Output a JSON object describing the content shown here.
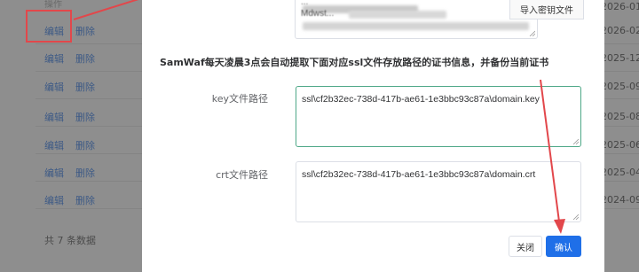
{
  "background": {
    "column_header": "操作",
    "rows": [
      {
        "edit": "编辑",
        "delete": "删除",
        "date": "2026-02-2"
      },
      {
        "edit": "编辑",
        "delete": "删除",
        "date": "2025-12-2"
      },
      {
        "edit": "编辑",
        "delete": "删除",
        "date": "2025-09-0"
      },
      {
        "edit": "编辑",
        "delete": "删除",
        "date": "2025-08-2"
      },
      {
        "edit": "编辑",
        "delete": "删除",
        "date": "2025-06-2"
      },
      {
        "edit": "编辑",
        "delete": "删除",
        "date": "2025-04-0"
      },
      {
        "edit": "编辑",
        "delete": "删除",
        "date": "2024-09-1"
      }
    ],
    "total": "共 7 条数据",
    "top_date": "2026-01-"
  },
  "dialog": {
    "blurred_line_1": "...",
    "blurred_line_2": "Mdwst...",
    "import_button": "导入密钥文件",
    "notice": "SamWaf每天凌晨3点会自动提取下面对应ssl文件存放路径的证书信息，并备份当前证书",
    "key_label": "key文件路径",
    "key_path": "ssl\\cf2b32ec-738d-417b-ae61-1e3bbc93c87a\\domain.key",
    "crt_label": "crt文件路径",
    "crt_path": "ssl\\cf2b32ec-738d-417b-ae61-1e3bbc93c87a\\domain.crt",
    "cancel_button": "关闭",
    "confirm_button": "确认"
  },
  "colors": {
    "annotation": "#e2474b",
    "primary": "#1f6fe8",
    "focus_border": "#4ea887"
  }
}
